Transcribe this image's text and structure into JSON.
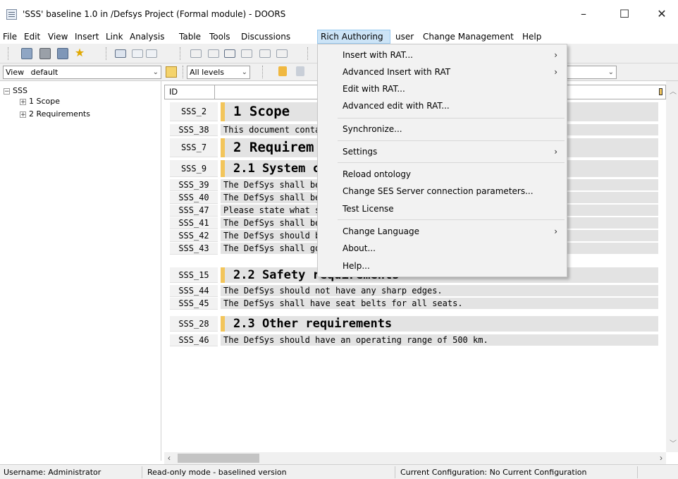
{
  "window": {
    "title": "'SSS' baseline 1.0 in /Defsys Project (Formal module) - DOORS",
    "minimize_glyph": "–",
    "maximize_glyph": "☐",
    "close_glyph": "✕"
  },
  "menubar": {
    "items": [
      "File",
      "Edit",
      "View",
      "Insert",
      "Link",
      "Analysis",
      "Table",
      "Tools",
      "Discussions",
      "Rich Authoring",
      "user",
      "Change Management",
      "Help"
    ]
  },
  "viewbar": {
    "view_label": "View",
    "view_value": "default",
    "levels_value": "All levels"
  },
  "tree": {
    "root": "SSS",
    "children": [
      "1 Scope",
      "2 Requirements"
    ]
  },
  "grid": {
    "id_header": "ID",
    "rows": [
      {
        "id": "SSS_2",
        "text": "1 Scope",
        "heading": true
      },
      {
        "id": "SSS_38",
        "text": "This document conta",
        "heading": false
      },
      {
        "id": "SSS_7",
        "text": "2 Requirem",
        "heading": true
      },
      {
        "id": "SSS_9",
        "text": "2.1 System ca",
        "heading": true
      },
      {
        "id": "SSS_39",
        "text": "The DefSys shall be",
        "heading": false
      },
      {
        "id": "SSS_40",
        "text": "The DefSys shall be",
        "heading": false
      },
      {
        "id": "SSS_47",
        "text": "Please state what s",
        "heading": false
      },
      {
        "id": "SSS_41",
        "text": "The DefSys shall be",
        "heading": false
      },
      {
        "id": "SSS_42",
        "text": "The DefSys should b",
        "heading": false
      },
      {
        "id": "SSS_43",
        "text": "The DefSys shall go",
        "heading": false
      },
      {
        "id": "SSS_15",
        "text": "2.2 Safety requirements",
        "heading": true
      },
      {
        "id": "SSS_44",
        "text": "The DefSys should not have any sharp edges.",
        "heading": false
      },
      {
        "id": "SSS_45",
        "text": "The DefSys shall have seat belts for all seats.",
        "heading": false
      },
      {
        "id": "SSS_28",
        "text": "2.3 Other requirements",
        "heading": true
      },
      {
        "id": "SSS_46",
        "text": "The DefSys should have an operating range of 500 km.",
        "heading": false
      }
    ]
  },
  "dropdown": {
    "items": [
      {
        "label": "Insert with RAT...",
        "submenu": true
      },
      {
        "label": "Advanced Insert with RAT",
        "submenu": true
      },
      {
        "label": "Edit with RAT...",
        "submenu": false
      },
      {
        "label": "Advanced edit with RAT...",
        "submenu": false
      },
      {
        "label": "Synchronize...",
        "submenu": false
      },
      {
        "label": "Settings",
        "submenu": true
      },
      {
        "label": "Reload ontology",
        "submenu": false
      },
      {
        "label": "Change SES Server connection parameters...",
        "submenu": false
      },
      {
        "label": "Test License",
        "submenu": false
      },
      {
        "label": "Change Language",
        "submenu": true
      },
      {
        "label": "About...",
        "submenu": false
      },
      {
        "label": "Help...",
        "submenu": false
      }
    ],
    "submenu_glyph": "›"
  },
  "statusbar": {
    "username": "Username: Administrator",
    "mode": "Read-only mode - baselined version",
    "configuration": "Current Configuration: No Current Configuration"
  },
  "colors": {
    "heading_marker": "#f2c55b",
    "menu_highlight": "#cce4f7",
    "row_background": "#e3e3e3"
  }
}
